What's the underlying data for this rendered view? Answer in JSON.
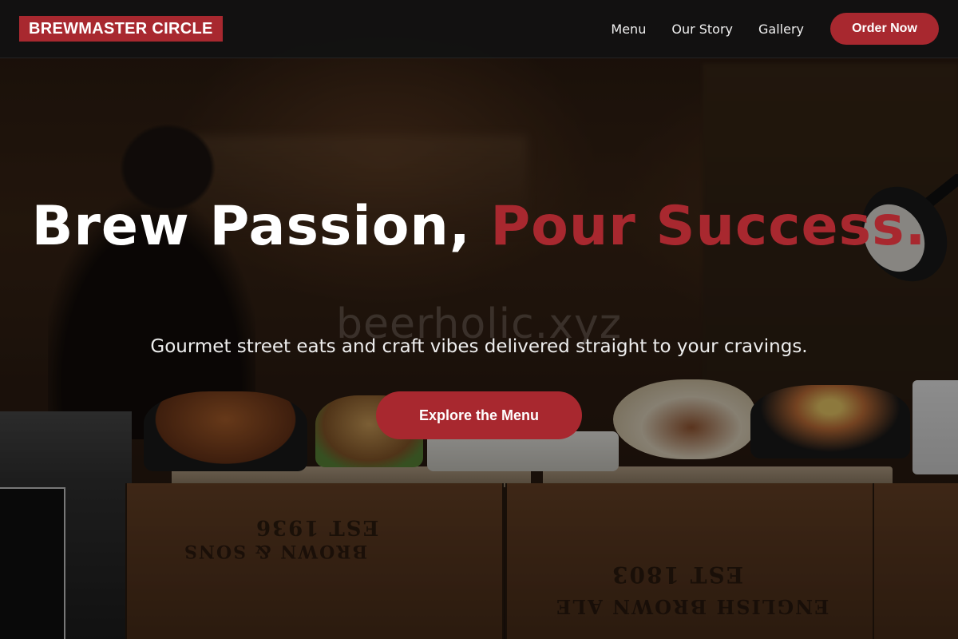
{
  "navbar": {
    "brand": "BREWMASTER CIRCLE",
    "links": [
      "Menu",
      "Our Story",
      "Gallery"
    ],
    "order_label": "Order Now"
  },
  "hero": {
    "title_part1": "Brew Passion, ",
    "title_accent": "Pour Success.",
    "watermark": "beerholic.xyz",
    "subtitle": "Gourmet street eats and craft vibes delivered straight to your cravings.",
    "cta_label": "Explore the Menu"
  },
  "background": {
    "crate_text_1": "EST 1936",
    "crate_text_2": "BROWN & SONS",
    "crate_text_3": "EST 1803",
    "crate_text_4": "ENGLISH BROWN ALE"
  },
  "colors": {
    "accent": "#a8282f",
    "navbar_bg": "#121212",
    "text": "#ffffff"
  }
}
